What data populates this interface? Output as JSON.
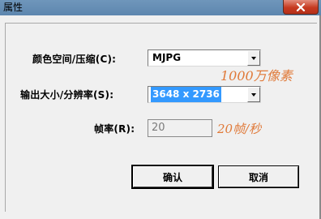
{
  "window": {
    "title": "属性"
  },
  "title_bar": {
    "close_icon": "close-x-icon"
  },
  "form": {
    "color_space_label": "颜色空间/压缩(C):",
    "color_space_value": "MJPG",
    "output_size_label": "输出大小/分辨率(S):",
    "output_size_value": "3648 x 2736",
    "frame_rate_label": "帧率(R):",
    "frame_rate_value": "20"
  },
  "annotations": {
    "resolution_note": "1000万像素",
    "frame_rate_note": "20帧/秒"
  },
  "buttons": {
    "ok_label": "确认",
    "cancel_label": "取消"
  },
  "colors": {
    "annotation": "#e07a3a",
    "selection": "#3399ff",
    "close_button": "#c63a1f"
  }
}
